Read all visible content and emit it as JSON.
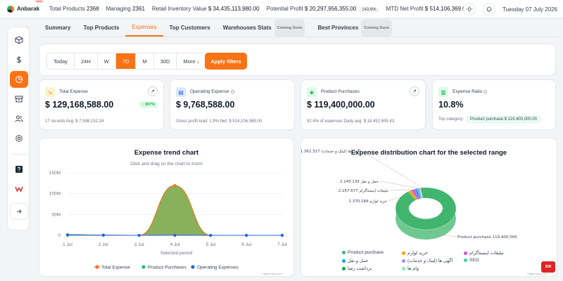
{
  "brand": {
    "name": "Anbarak",
    "badge": "beta"
  },
  "topbar": {
    "total_products_label": "Total Products",
    "total_products": "2368",
    "managing_label": "Managing",
    "managing": "2361",
    "inventory_label": "Retail Inventory Value",
    "inventory": "$ 34,435,113,980.00",
    "profit_label": "Potential Profit",
    "profit": "$ 20,297,956,355.00",
    "profit_pct": "143.6%",
    "mtd_label": "MTD Net Profit",
    "mtd": "$ 514,106,369.00",
    "date": "Tuesday 07 July 2026"
  },
  "tabs": [
    {
      "label": "Summary"
    },
    {
      "label": "Top Products"
    },
    {
      "label": "Expenses",
      "active": true
    },
    {
      "label": "Top Customers"
    },
    {
      "label": "Warehouses Stats",
      "soon": "Coming Soon"
    },
    {
      "label": "Best Provinces",
      "soon": "Coming Soon"
    }
  ],
  "filters": {
    "ranges": [
      "Today",
      "24H",
      "W",
      "7D",
      "M",
      "30D",
      "More ↓"
    ],
    "active_range": "7D",
    "apply_label": "Apply filters"
  },
  "kpis": {
    "total_expense": {
      "label": "Total Expense",
      "value": "$ 129,168,588.00",
      "badge": "↑ 307%",
      "foot": "17 records   Avg: $ 7,598,152.24"
    },
    "operating_expense": {
      "label": "Operating Expense",
      "value": "$ 9,768,588.00",
      "foot": "Gross profit load: 1.9%   Net: $ 514,106,369.00"
    },
    "product_purchases": {
      "label": "Product Purchases",
      "value": "$ 119,400,000.00",
      "foot": "92.4% of expenses   Daily avg: $ 18,452,655.43"
    },
    "expense_ratio": {
      "label": "Expense Ratio",
      "value": "10.8%",
      "foot_label": "Top category:",
      "foot_badge": "Product purchase $ 119,400,000.00"
    }
  },
  "trend_chart": {
    "title": "Expense trend chart",
    "subtitle": "Click and drag on the chart to zoom",
    "credit": "Highcharts.com"
  },
  "dist_chart": {
    "title": "Expense distribution chart for the selected range",
    "credit": "Highcharts.com"
  },
  "chart_data": [
    {
      "type": "area",
      "title": "Expense trend chart",
      "subtitle": "Click and drag on the chart to zoom",
      "xlabel": "Selected period",
      "ylabel": "",
      "categories": [
        "1 Jul",
        "2 Jul",
        "3 Jul",
        "4 Jul",
        "5 Jul",
        "6 Jul",
        "7 Jul"
      ],
      "y_ticks": [
        "0",
        "50M",
        "100M",
        "150M"
      ],
      "ylim": [
        0,
        150000000
      ],
      "grid": true,
      "legend_placement": "bottom",
      "series": [
        {
          "name": "Total Expense",
          "color": "#f97316",
          "values": [
            1600000,
            600000,
            0,
            119400000,
            0,
            0,
            0
          ]
        },
        {
          "name": "Product Purchases",
          "color": "#22c55e",
          "values": [
            0,
            0,
            0,
            119400000,
            0,
            0,
            0
          ]
        },
        {
          "name": "Operating Expenses",
          "color": "#2563eb",
          "values": [
            1600000,
            600000,
            0,
            0,
            0,
            0,
            0
          ]
        }
      ]
    },
    {
      "type": "pie",
      "variant": "3d-donut",
      "title": "Expense distribution chart for the selected range",
      "legend_placement": "bottom",
      "slices": [
        {
          "name": "Product purchase",
          "value": 119400000,
          "color": "#3fb56d",
          "label": "Product purchase 119.400.000"
        },
        {
          "name": "خرید لوازم",
          "value": 2370184,
          "color": "#f59e0b",
          "label": "خرید لوازم 2.370.184"
        },
        {
          "name": "تبلیغات اینستاگرام",
          "value": 2167677,
          "color": "#d946ef",
          "label": "تبلیغات اینستاگرام 2.167.677"
        },
        {
          "name": "حمل و نقل",
          "value": 2145135,
          "color": "#0ea5e9",
          "label": "حمل و نقل 2.145.135"
        },
        {
          "name": "آگهی ها (لینک و خدمات)",
          "value": 1362317,
          "color": "#a78bfa",
          "label": "آگهی ها (لینک و خدمات) 1.362.317"
        },
        {
          "name": "SEO",
          "value": 400000,
          "color": "#34d399"
        },
        {
          "name": "برداشت رضا",
          "value": 300000,
          "color": "#16a34a"
        },
        {
          "name": "وام ها",
          "value": 200000,
          "color": "#86efac"
        }
      ]
    }
  ],
  "help": {
    "label": "BIR"
  }
}
